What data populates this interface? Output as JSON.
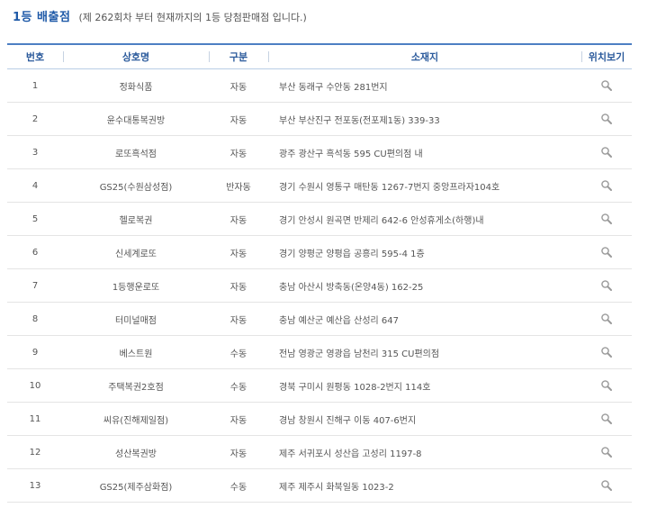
{
  "heading": {
    "title": "1등 배출점",
    "subtitle": "(제 262회차 부터 현재까지의 1등 당첨판매점 입니다.)"
  },
  "table": {
    "columns": [
      "번호",
      "상호명",
      "구분",
      "소재지",
      "위치보기"
    ],
    "rows": [
      {
        "no": "1",
        "name": "정화식품",
        "type": "자동",
        "address": "부산 동래구 수안동 281번지",
        "icon": "magnifier-icon"
      },
      {
        "no": "2",
        "name": "윤수대통복권방",
        "type": "자동",
        "address": "부산 부산진구 전포동(전포제1동) 339-33",
        "icon": "magnifier-icon"
      },
      {
        "no": "3",
        "name": "로또흑석점",
        "type": "자동",
        "address": "광주 광산구 흑석동 595 CU편의점 내",
        "icon": "magnifier-icon"
      },
      {
        "no": "4",
        "name": "GS25(수원삼성점)",
        "type": "반자동",
        "address": "경기 수원시 영통구 매탄동 1267-7번지 중앙프라자104호",
        "icon": "magnifier-icon"
      },
      {
        "no": "5",
        "name": "헬로복권",
        "type": "자동",
        "address": "경기 안성시 원곡면 반제리 642-6 안성휴게소(하행)내",
        "icon": "magnifier-icon"
      },
      {
        "no": "6",
        "name": "신세계로또",
        "type": "자동",
        "address": "경기 양평군 양평읍 공흥리 595-4 1층",
        "icon": "magnifier-icon"
      },
      {
        "no": "7",
        "name": "1등행운로또",
        "type": "자동",
        "address": "충남 아산시 방축동(온양4동) 162-25",
        "icon": "magnifier-icon"
      },
      {
        "no": "8",
        "name": "터미널매점",
        "type": "자동",
        "address": "충남 예산군 예산읍 산성리 647",
        "icon": "magnifier-icon"
      },
      {
        "no": "9",
        "name": "베스트원",
        "type": "수동",
        "address": "전남 영광군 영광읍 남천리 315 CU편의점",
        "icon": "magnifier-icon"
      },
      {
        "no": "10",
        "name": "주택복권2호점",
        "type": "수동",
        "address": "경북 구미시 원평동 1028-2번지 114호",
        "icon": "magnifier-icon"
      },
      {
        "no": "11",
        "name": "씨유(진해제일점)",
        "type": "자동",
        "address": "경남 창원시 진해구 이동 407-6번지",
        "icon": "magnifier-icon"
      },
      {
        "no": "12",
        "name": "성산복권방",
        "type": "자동",
        "address": "제주 서귀포시 성산읍 고성리 1197-8",
        "icon": "magnifier-icon"
      },
      {
        "no": "13",
        "name": "GS25(제주삼화점)",
        "type": "수동",
        "address": "제주 제주시 화북일동 1023-2",
        "icon": "magnifier-icon"
      }
    ]
  },
  "colors": {
    "title": "#1f5aa8",
    "header_text": "#2c5b9c",
    "header_border": "#4d7fc3"
  }
}
